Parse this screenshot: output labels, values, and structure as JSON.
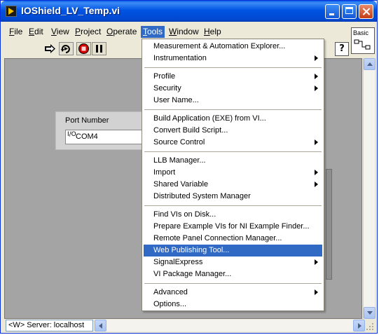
{
  "window": {
    "title": "IOShield_LV_Temp.vi"
  },
  "menubar": [
    {
      "label": "File",
      "u": "F",
      "rest": "ile"
    },
    {
      "label": "Edit",
      "u": "E",
      "rest": "dit"
    },
    {
      "label": "View",
      "u": "V",
      "rest": "iew"
    },
    {
      "label": "Project",
      "u": "P",
      "rest": "roject"
    },
    {
      "label": "Operate",
      "u": "O",
      "rest": "perate"
    },
    {
      "label": "Tools",
      "u": "T",
      "rest": "ools"
    },
    {
      "label": "Window",
      "u": "W",
      "rest": "indow"
    },
    {
      "label": "Help",
      "u": "H",
      "rest": "elp"
    }
  ],
  "palette_label": "Basic",
  "help_symbol": "?",
  "front_panel": {
    "cluster_label": "Port Number",
    "io_glyph": "I/O",
    "port_value": "COM4"
  },
  "status": {
    "server": "<W> Server: localhost"
  },
  "tools_menu": [
    {
      "label": "Measurement & Automation Explorer...",
      "submenu": false
    },
    {
      "label": "Instrumentation",
      "submenu": true
    },
    {
      "label": "Profile",
      "submenu": true
    },
    {
      "label": "Security",
      "submenu": true
    },
    {
      "label": "User Name...",
      "submenu": false
    },
    {
      "label": "Build Application (EXE) from VI...",
      "submenu": false
    },
    {
      "label": "Convert Build Script...",
      "submenu": false
    },
    {
      "label": "Source Control",
      "submenu": true
    },
    {
      "label": "LLB Manager...",
      "submenu": false
    },
    {
      "label": "Import",
      "submenu": true
    },
    {
      "label": "Shared Variable",
      "submenu": true
    },
    {
      "label": "Distributed System Manager",
      "submenu": false
    },
    {
      "label": "Find VIs on Disk...",
      "submenu": false
    },
    {
      "label": "Prepare Example VIs for NI Example Finder...",
      "submenu": false
    },
    {
      "label": "Remote Panel Connection Manager...",
      "submenu": false
    },
    {
      "label": "Web Publishing Tool...",
      "submenu": false,
      "highlighted": true
    },
    {
      "label": "SignalExpress",
      "submenu": true
    },
    {
      "label": "VI Package Manager...",
      "submenu": false
    },
    {
      "label": "Advanced",
      "submenu": true
    },
    {
      "label": "Options...",
      "submenu": false
    }
  ],
  "colors": {
    "titlebar": "#0054e3",
    "highlight": "#316ac5",
    "panel": "#a4a4a4"
  },
  "toolbar_icons": [
    "run-arrow-icon",
    "run-continuously-icon",
    "abort-icon",
    "pause-icon"
  ]
}
